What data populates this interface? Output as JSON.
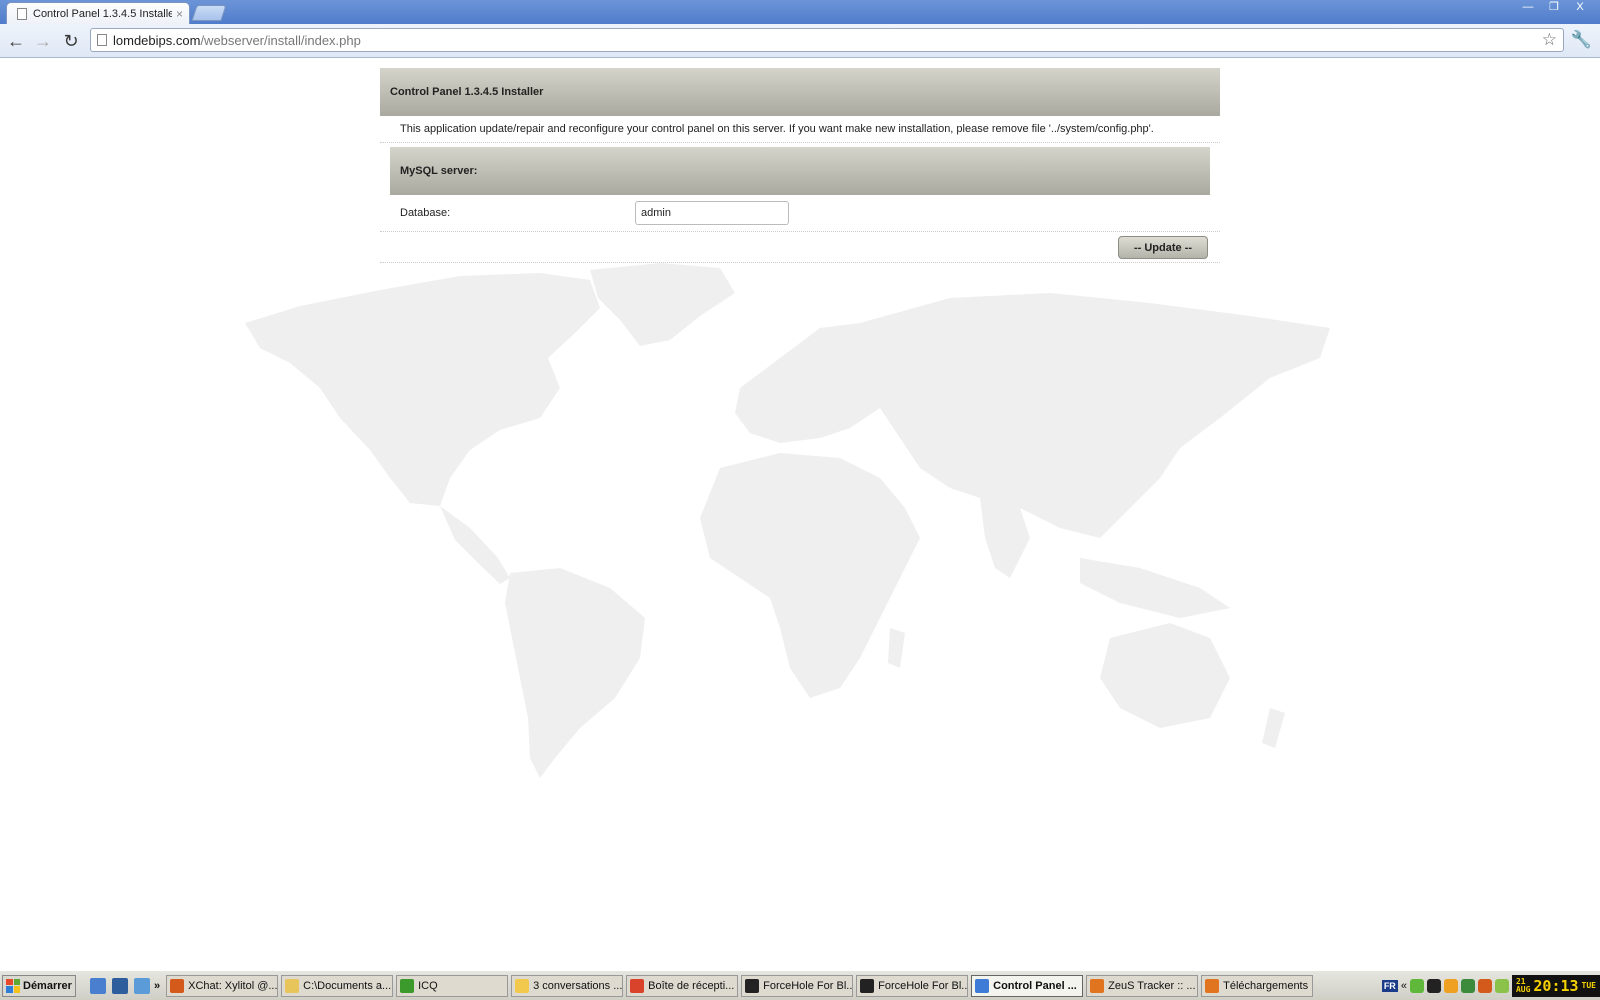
{
  "browser": {
    "tab_title": "Control Panel 1.3.4.5 Installe",
    "tab_close": "×",
    "url_domain": "lomdebips.com",
    "url_path": "/webserver/install/index.php",
    "window_buttons": [
      "—",
      "❐",
      "X"
    ]
  },
  "installer": {
    "header": "Control Panel 1.3.4.5 Installer",
    "intro": "This application update/repair and reconfigure your control panel on this server. If you want make new installation, please remove file '../system/config.php'.",
    "section_title": "MySQL server:",
    "database_label": "Database:",
    "database_value": "admin",
    "update_button": "-- Update --"
  },
  "taskbar": {
    "start": "Démarrer",
    "more": "»",
    "tasks": [
      {
        "label": "XChat: Xylitol @...",
        "color": "#d45a1c"
      },
      {
        "label": "C:\\Documents a...",
        "color": "#e8c55a"
      },
      {
        "label": "ICQ",
        "color": "#3c9a2c"
      },
      {
        "label": "3 conversations ...",
        "color": "#f2c94c"
      },
      {
        "label": "Boîte de récepti...",
        "color": "#d9432c"
      },
      {
        "label": "ForceHole For Bl...",
        "color": "#222222"
      },
      {
        "label": "ForceHole For Bl...",
        "color": "#222222"
      },
      {
        "label": "Control Panel ...",
        "color": "#3d7bd6"
      },
      {
        "label": "ZeuS Tracker :: ...",
        "color": "#e0741f"
      },
      {
        "label": "Téléchargements",
        "color": "#e0741f"
      }
    ],
    "lang": "FR",
    "tray_arrow": "«",
    "clock_date_top": "21",
    "clock_date_bottom": "AUG",
    "clock_time": "20:13",
    "clock_day": "TUE"
  }
}
